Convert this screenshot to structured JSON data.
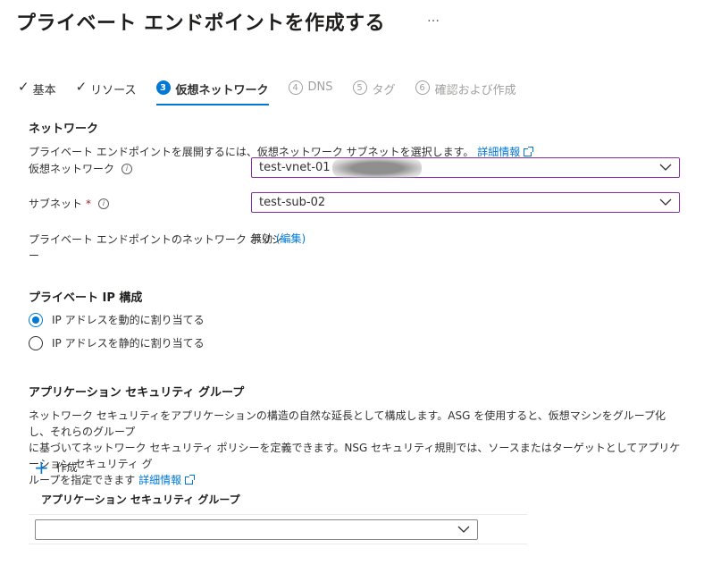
{
  "page": {
    "title": "プライベート エンドポイントを作成する",
    "more": "…"
  },
  "tabs": [
    {
      "label": "基本",
      "state": "done"
    },
    {
      "label": "リソース",
      "state": "done"
    },
    {
      "label": "仮想ネットワーク",
      "num": "3",
      "state": "active"
    },
    {
      "label": "DNS",
      "num": "4",
      "state": "disabled"
    },
    {
      "label": "タグ",
      "num": "5",
      "state": "disabled"
    },
    {
      "label": "確認および作成",
      "num": "6",
      "state": "disabled"
    }
  ],
  "network": {
    "section_title": "ネットワーク",
    "description": "プライベート エンドポイントを展開するには、仮想ネットワーク サブネットを選択します。",
    "learn_more": "詳細情報",
    "vnet_label": "仮想ネットワーク",
    "vnet_value": "test-vnet-01",
    "subnet_label": "サブネット",
    "subnet_required": "*",
    "subnet_value": "test-sub-02",
    "policy_label_line1": "プライベート エンドポイントのネットワーク ポリシ",
    "policy_label_line2": "ー",
    "policy_value": "無効",
    "policy_edit": "(編集)"
  },
  "ip_config": {
    "section_title": "プライベート IP 構成",
    "options": [
      {
        "label": "IP アドレスを動的に割り当てる",
        "checked": true
      },
      {
        "label": "IP アドレスを静的に割り当てる",
        "checked": false
      }
    ]
  },
  "asg": {
    "section_title": "アプリケーション セキュリティ グループ",
    "desc_line1": "ネットワーク セキュリティをアプリケーションの構造の自然な延長として構成します。ASG を使用すると、仮想マシンをグループ化し、それらのグループ",
    "desc_line2": "に基づいてネットワーク セキュリティ ポリシーを定義できます。NSG セキュリティ規則では、ソースまたはターゲットとしてアプリケーション セキュリティ グ",
    "desc_line3": "ループを指定できます",
    "learn_more": "詳細情報",
    "create_label": "作成",
    "grid_header": "アプリケーション セキュリティ グループ",
    "grid_value": ""
  },
  "colors": {
    "accent": "#0078d4",
    "focus_border": "#8a2da5",
    "required": "#a4262c"
  }
}
